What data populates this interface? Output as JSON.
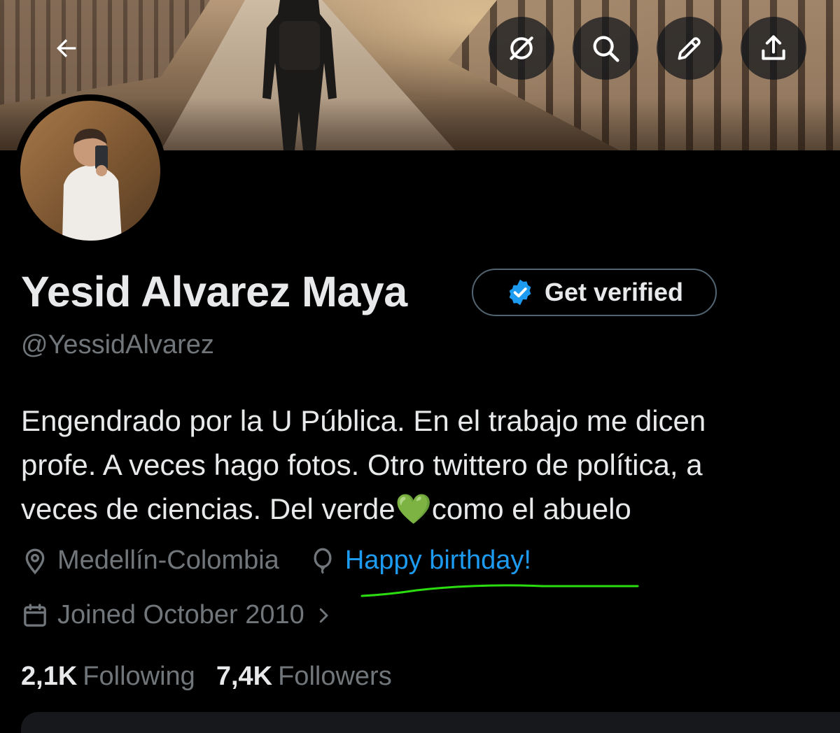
{
  "profile": {
    "name": "Yesid Alvarez Maya",
    "handle": "@YessidAlvarez",
    "verify_label": "Get verified",
    "bio_lines": [
      "Engendrado por la U Pública. En el trabajo me dicen",
      "profe. A veces hago fotos. Otro twittero de política, a",
      "veces de ciencias. Del verde",
      "como el abuelo"
    ],
    "bio_emoji": "💚",
    "location": "Medellín-Colombia",
    "birthday": "Happy birthday!",
    "joined": "Joined October 2010"
  },
  "stats": {
    "following_count": "2,1K",
    "following_label": "Following",
    "followers_count": "7,4K",
    "followers_label": "Followers"
  },
  "colors": {
    "background": "#000000",
    "primary_text": "#e7e9ea",
    "secondary_text": "#71767b",
    "accent_blue": "#1d9bf0",
    "highlight_green": "#2bdc10"
  },
  "icons": {
    "back": "arrow-left-icon",
    "grok": "grok-icon",
    "search": "search-icon",
    "edit": "pencil-icon",
    "share": "share-icon",
    "verified": "verified-badge-icon",
    "location": "location-pin-icon",
    "birthday": "balloon-icon",
    "joined": "calendar-icon",
    "chevron": "chevron-right-icon"
  }
}
